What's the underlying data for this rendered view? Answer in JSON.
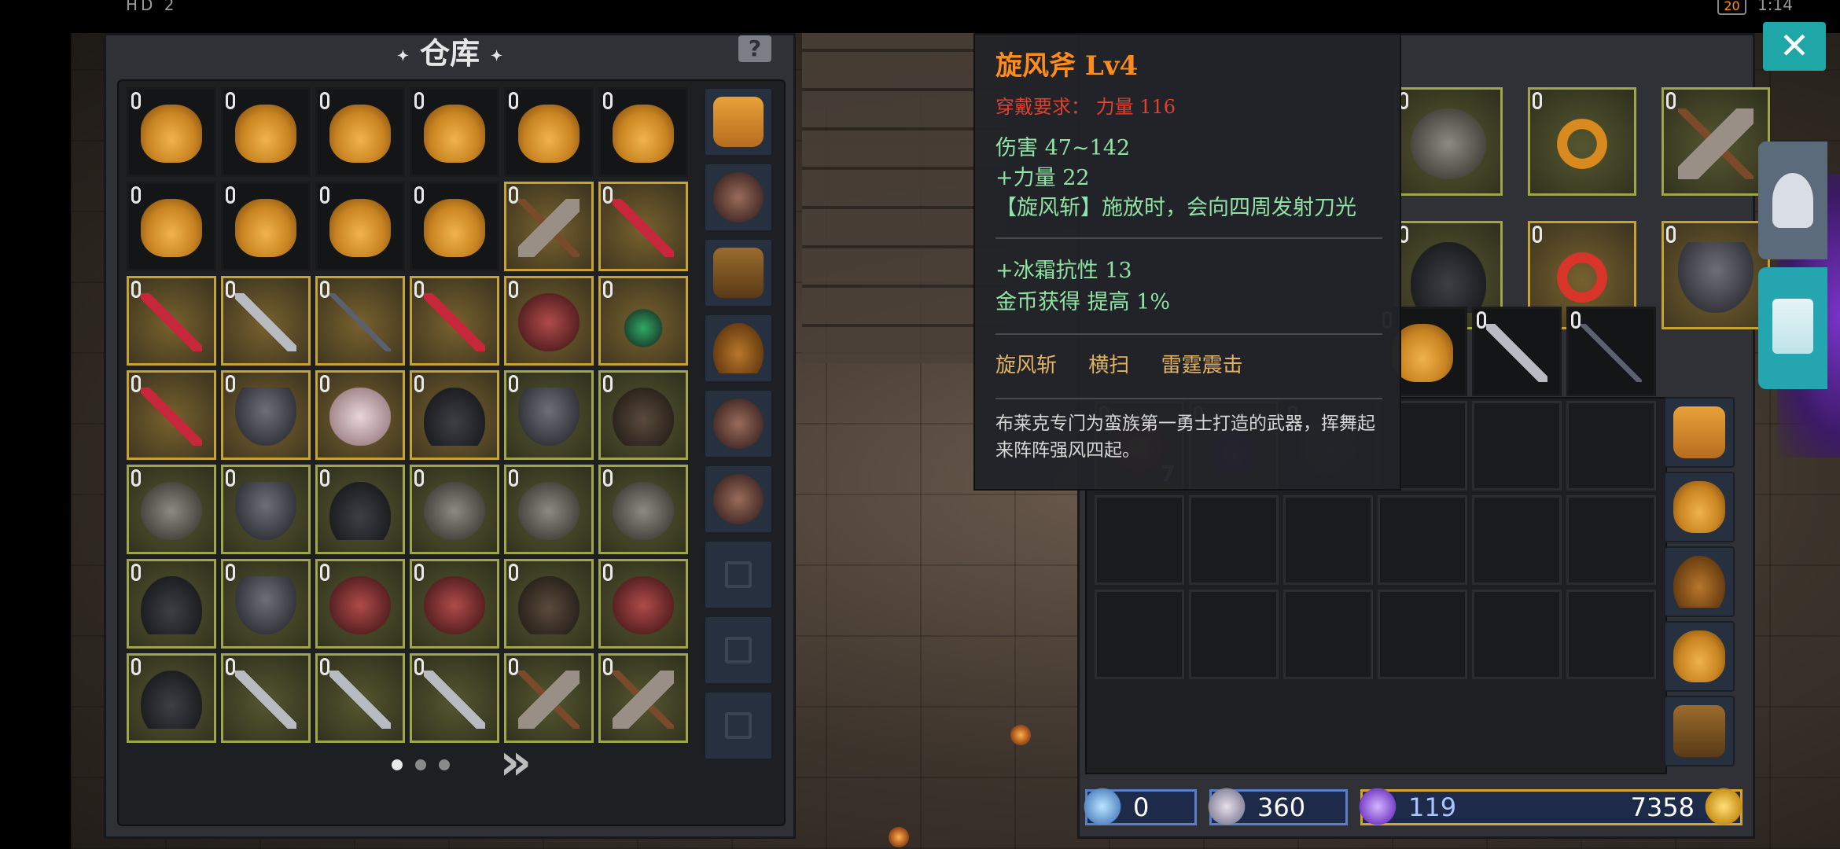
{
  "status_bar": {
    "left": "HD 2",
    "battery": "20",
    "time": "1:14"
  },
  "warehouse": {
    "title": "仓库",
    "help_label": "?",
    "next_label": "»",
    "pages": 3,
    "active_page": 1,
    "rows": [
      [
        {
          "item": "pouch",
          "frame": "dark"
        },
        {
          "item": "pouch",
          "frame": "dark"
        },
        {
          "item": "pouch",
          "frame": "dark"
        },
        {
          "item": "pouch",
          "frame": "dark"
        },
        {
          "item": "pouch",
          "frame": "dark"
        },
        {
          "item": "pouch",
          "frame": "dark"
        }
      ],
      [
        {
          "item": "pouch",
          "frame": "dark"
        },
        {
          "item": "pouch",
          "frame": "dark"
        },
        {
          "item": "pouch",
          "frame": "dark"
        },
        {
          "item": "pouch",
          "frame": "dark"
        },
        {
          "item": "axe",
          "frame": "gold"
        },
        {
          "item": "blade-red",
          "frame": "gold"
        }
      ],
      [
        {
          "item": "blade-red",
          "frame": "gold"
        },
        {
          "item": "sword",
          "frame": "gold"
        },
        {
          "item": "spear",
          "frame": "gold"
        },
        {
          "item": "blade-red",
          "frame": "gold"
        },
        {
          "item": "robe",
          "frame": "gold"
        },
        {
          "item": "amulet",
          "frame": "gold"
        }
      ],
      [
        {
          "item": "blade-red",
          "frame": "gold"
        },
        {
          "item": "helm",
          "frame": "gold"
        },
        {
          "item": "mask",
          "frame": "gold"
        },
        {
          "item": "boots",
          "frame": "gold"
        },
        {
          "item": "helm",
          "frame": "olive"
        },
        {
          "item": "gauntlet",
          "frame": "olive"
        }
      ],
      [
        {
          "item": "armor",
          "frame": "olive"
        },
        {
          "item": "helm",
          "frame": "olive"
        },
        {
          "item": "boots",
          "frame": "olive"
        },
        {
          "item": "armor",
          "frame": "olive"
        },
        {
          "item": "armor",
          "frame": "olive"
        },
        {
          "item": "armor",
          "frame": "olive"
        }
      ],
      [
        {
          "item": "boots",
          "frame": "olive"
        },
        {
          "item": "helm",
          "frame": "olive"
        },
        {
          "item": "robe",
          "frame": "olive"
        },
        {
          "item": "robe",
          "frame": "olive"
        },
        {
          "item": "gauntlet",
          "frame": "olive"
        },
        {
          "item": "robe",
          "frame": "olive"
        }
      ],
      [
        {
          "item": "boots",
          "frame": "olive"
        },
        {
          "item": "sword",
          "frame": "olive"
        },
        {
          "item": "sword",
          "frame": "olive"
        },
        {
          "item": "sword",
          "frame": "olive"
        },
        {
          "item": "axe",
          "frame": "olive"
        },
        {
          "item": "axe",
          "frame": "olive"
        }
      ]
    ],
    "side_bags": [
      "bag",
      "pack",
      "greenbag",
      "sack",
      "pack",
      "pack",
      "locked",
      "locked",
      "locked"
    ]
  },
  "equipment": {
    "close_label": "✕",
    "tabs": [
      "helm-icon",
      "weapon-icon"
    ],
    "slots": [
      {
        "item": "armor",
        "frame": "olive"
      },
      {
        "item": "ring",
        "frame": "olive"
      },
      {
        "item": "axe",
        "frame": "olive"
      },
      {
        "item": "boots",
        "frame": "olive"
      },
      {
        "item": "ring-red",
        "frame": "gold"
      },
      {
        "item": "helm",
        "frame": "gold"
      }
    ]
  },
  "backpack": {
    "rows": [
      [
        {
          "item": "pouch",
          "frame": "dark"
        },
        {
          "item": "sword",
          "frame": "dark"
        },
        {
          "item": "spear",
          "frame": "dark"
        }
      ],
      [
        {
          "item": "scroll",
          "frame": "gold",
          "count": "7"
        },
        {
          "item": "potion",
          "frame": "gold"
        },
        {
          "item": "shield",
          "frame": "dark"
        },
        {
          "item": "",
          "frame": "empty"
        },
        {
          "item": "",
          "frame": "empty"
        },
        {
          "item": "",
          "frame": "empty"
        }
      ],
      [
        {
          "item": "",
          "frame": "empty"
        },
        {
          "item": "",
          "frame": "empty"
        },
        {
          "item": "",
          "frame": "empty"
        },
        {
          "item": "",
          "frame": "empty"
        },
        {
          "item": "",
          "frame": "empty"
        },
        {
          "item": "",
          "frame": "empty"
        }
      ],
      [
        {
          "item": "",
          "frame": "empty"
        },
        {
          "item": "",
          "frame": "empty"
        },
        {
          "item": "",
          "frame": "empty"
        },
        {
          "item": "",
          "frame": "empty"
        },
        {
          "item": "",
          "frame": "empty"
        },
        {
          "item": "",
          "frame": "empty"
        }
      ]
    ],
    "side_bags": [
      "bag",
      "pouch",
      "sack",
      "pouch",
      "greenbag"
    ]
  },
  "resources": {
    "crafting": "0",
    "soul": "360",
    "crystal": "119",
    "gold": "7358"
  },
  "tooltip": {
    "name": "旋风斧 Lv4",
    "requirement": "穿戴要求： 力量 116",
    "damage": "伤害 47~142",
    "strength": "+力量 22",
    "effect": "【旋风斩】施放时，会向四周发射刀光",
    "frost": "+冰霜抗性 13",
    "gold_find": "金币获得 提高 1%",
    "skills": [
      "旋风斩",
      "横扫",
      "雷霆震击"
    ],
    "description": "布莱克专门为蛮族第一勇士打造的武器，挥舞起来阵阵强风四起。"
  }
}
